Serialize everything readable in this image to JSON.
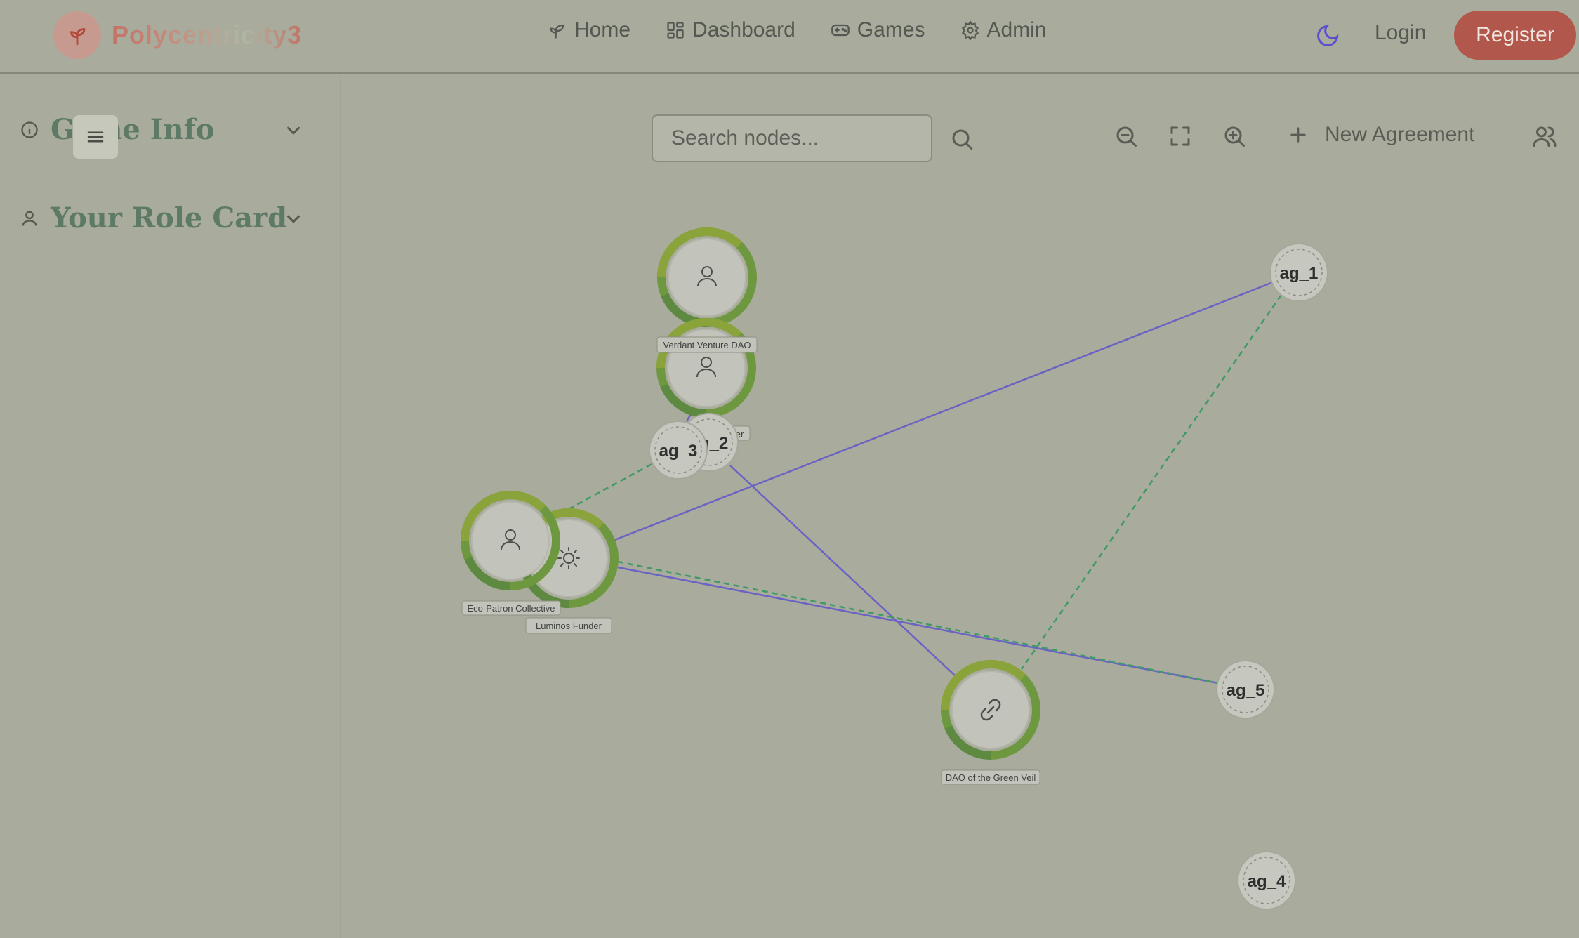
{
  "app": {
    "name": "Polycentricity3"
  },
  "nav": {
    "items": [
      {
        "label": "Home"
      },
      {
        "label": "Dashboard"
      },
      {
        "label": "Games"
      },
      {
        "label": "Admin"
      }
    ],
    "login": "Login",
    "register": "Register"
  },
  "sidebar": {
    "game_info": "Game Info",
    "role_card": "Your Role Card"
  },
  "toolbar": {
    "search_placeholder": "Search nodes...",
    "new_agreement": "New Agreement"
  },
  "graph": {
    "actors": [
      {
        "label": "Verdant Venture DAO",
        "icon": "user-icon"
      },
      {
        "label": "…er",
        "icon": "user-icon"
      },
      {
        "label": "Eco-Patron Collective",
        "icon": "user-icon"
      },
      {
        "label": "Luminos Funder",
        "icon": "sun-icon"
      },
      {
        "label": "DAO of the Green Veil",
        "icon": "link-icon"
      }
    ],
    "agreements": [
      "ag_1",
      "ag_2",
      "ag_3",
      "ag_4",
      "ag_5"
    ]
  },
  "colors": {
    "background": "#a9ab9c",
    "solid_edge": "#6a63c4",
    "dashed_edge": "#3f9a66",
    "ring_light": "#8aa33a",
    "ring_dark": "#5d8a40",
    "register": "#b2574b",
    "theme_icon": "#5a4fd0"
  }
}
